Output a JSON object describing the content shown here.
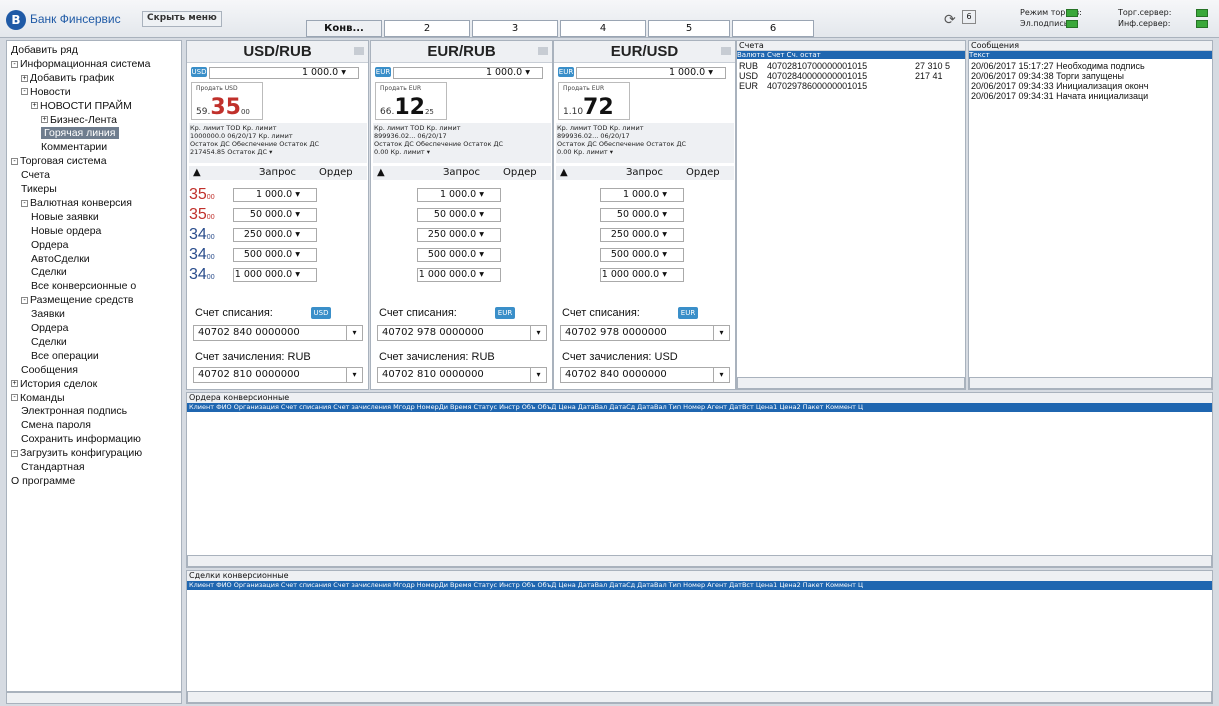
{
  "header": {
    "logo_letter": "B",
    "bank_name": "Банк Финсервис",
    "hide_menu": "Скрыть меню",
    "tabs": [
      "Конв...",
      "2",
      "3",
      "4",
      "5",
      "6"
    ],
    "status": {
      "trading_mode": "Режим торгов:",
      "trade_server": "Торг.сервер:",
      "signature": "Эл.подпись:",
      "info_server": "Инф.сервер:"
    },
    "refresh_icon": "⟳",
    "lock_icon": "6"
  },
  "tree": [
    {
      "label": "Добавить ряд",
      "indent": 0,
      "expander": ""
    },
    {
      "label": "Информационная система",
      "indent": 0,
      "expander": "-"
    },
    {
      "label": "Добавить график",
      "indent": 1,
      "expander": "+"
    },
    {
      "label": "Новости",
      "indent": 1,
      "expander": "-"
    },
    {
      "label": "НОВОСТИ ПРАЙМ",
      "indent": 2,
      "expander": "+"
    },
    {
      "label": "Бизнес-Лента",
      "indent": 3,
      "expander": "+"
    },
    {
      "label": "Горячая линия",
      "indent": 3,
      "expander": "",
      "selected": true
    },
    {
      "label": "Комментарии",
      "indent": 3,
      "expander": ""
    },
    {
      "label": "Торговая система",
      "indent": 0,
      "expander": "-"
    },
    {
      "label": "Счета",
      "indent": 1,
      "expander": ""
    },
    {
      "label": "Тикеры",
      "indent": 1,
      "expander": ""
    },
    {
      "label": "Валютная конверсия",
      "indent": 1,
      "expander": "-"
    },
    {
      "label": "Новые заявки",
      "indent": 2,
      "expander": ""
    },
    {
      "label": "Новые ордера",
      "indent": 2,
      "expander": ""
    },
    {
      "label": "Ордера",
      "indent": 2,
      "expander": ""
    },
    {
      "label": "АвтоСделки",
      "indent": 2,
      "expander": ""
    },
    {
      "label": "Сделки",
      "indent": 2,
      "expander": ""
    },
    {
      "label": "Все конверсионные о",
      "indent": 2,
      "expander": ""
    },
    {
      "label": "Размещение средств",
      "indent": 1,
      "expander": "-"
    },
    {
      "label": "Заявки",
      "indent": 2,
      "expander": ""
    },
    {
      "label": "Ордера",
      "indent": 2,
      "expander": ""
    },
    {
      "label": "Сделки",
      "indent": 2,
      "expander": ""
    },
    {
      "label": "Все операции",
      "indent": 2,
      "expander": ""
    },
    {
      "label": "Сообщения",
      "indent": 1,
      "expander": ""
    },
    {
      "label": "История сделок",
      "indent": 0,
      "expander": "+"
    },
    {
      "label": "Команды",
      "indent": 0,
      "expander": "-"
    },
    {
      "label": "Электронная подпись",
      "indent": 1,
      "expander": ""
    },
    {
      "label": "Смена пароля",
      "indent": 1,
      "expander": ""
    },
    {
      "label": "Сохранить информацию",
      "indent": 1,
      "expander": ""
    },
    {
      "label": "Загрузить конфигурацию",
      "indent": 0,
      "expander": "-"
    },
    {
      "label": "Стандартная",
      "indent": 1,
      "expander": ""
    },
    {
      "label": "О программе",
      "indent": 0,
      "expander": ""
    }
  ],
  "panels": [
    {
      "title": "USD/RUB",
      "ccy": "USD",
      "amount": "1 000.0 ▾",
      "sell_label": "Продать USD",
      "rate_prefix": "59.",
      "rate_big": "35",
      "rate_suffix": "00",
      "rate_red": true,
      "info1": "Кр. лимит      TOD        Кр. лимит",
      "info2": "1000000.0   06/20/17   Кр. лимит",
      "info3": "Остаток ДС  Обеспечение  Остаток ДС",
      "info4": "217454.85  Остаток ДС ▾",
      "btn_request": "Запрос",
      "btn_order": "Ордер",
      "levels": [
        {
          "price": "35",
          "sub": "00",
          "qty": "1 000.0 ▾"
        },
        {
          "price": "35",
          "sub": "00",
          "qty": "50 000.0 ▾"
        },
        {
          "price": "34",
          "sub": "00",
          "qty": "250 000.0 ▾"
        },
        {
          "price": "34",
          "sub": "00",
          "qty": "500 000.0 ▾"
        },
        {
          "price": "34",
          "sub": "00",
          "qty": "1 000 000.0 ▾"
        }
      ],
      "debit_label": "Счет списания:",
      "debit_ccy": "USD",
      "debit_acct": "40702 840  0000000",
      "credit_label": "Счет зачисления:  RUB",
      "credit_acct": "40702 810  0000000"
    },
    {
      "title": "EUR/RUB",
      "ccy": "EUR",
      "amount": "1 000.0 ▾",
      "sell_label": "Продать EUR",
      "rate_prefix": "66.",
      "rate_big": "12",
      "rate_suffix": "25",
      "rate_red": false,
      "info1": "Кр. лимит      TOD        Кр. лимит",
      "info2": "899936.02...  06/20/17",
      "info3": "Остаток ДС  Обеспечение  Остаток ДС",
      "info4": "0.00  Кр. лимит ▾",
      "btn_request": "Запрос",
      "btn_order": "Ордер",
      "levels": [
        {
          "price": "",
          "sub": "",
          "qty": "1 000.0 ▾"
        },
        {
          "price": "",
          "sub": "",
          "qty": "50 000.0 ▾"
        },
        {
          "price": "",
          "sub": "",
          "qty": "250 000.0 ▾"
        },
        {
          "price": "",
          "sub": "",
          "qty": "500 000.0 ▾"
        },
        {
          "price": "",
          "sub": "",
          "qty": "1 000 000.0 ▾"
        }
      ],
      "debit_label": "Счет списания:",
      "debit_ccy": "EUR",
      "debit_acct": "40702 978  0000000",
      "credit_label": "Счет зачисления:  RUB",
      "credit_acct": "40702 810  0000000"
    },
    {
      "title": "EUR/USD",
      "ccy": "EUR",
      "amount": "1 000.0 ▾",
      "sell_label": "Продать EUR",
      "rate_prefix": "1.10",
      "rate_big": "72",
      "rate_suffix": "",
      "rate_red": false,
      "info1": "Кр. лимит      TOD        Кр. лимит",
      "info2": "899936.02...  06/20/17",
      "info3": "Остаток ДС  Обеспечение  Остаток ДС",
      "info4": "0.00  Кр. лимит ▾",
      "btn_request": "Запрос",
      "btn_order": "Ордер",
      "levels": [
        {
          "price": "",
          "sub": "",
          "qty": "1 000.0 ▾"
        },
        {
          "price": "",
          "sub": "",
          "qty": "50 000.0 ▾"
        },
        {
          "price": "",
          "sub": "",
          "qty": "250 000.0 ▾"
        },
        {
          "price": "",
          "sub": "",
          "qty": "500 000.0 ▾"
        },
        {
          "price": "",
          "sub": "",
          "qty": "1 000 000.0 ▾"
        }
      ],
      "debit_label": "Счет списания:",
      "debit_ccy": "EUR",
      "debit_acct": "40702 978  0000000",
      "credit_label": "Счет зачисления:  USD",
      "credit_acct": "40702 840  0000000"
    }
  ],
  "accounts": {
    "title": "Счета",
    "header": "Валюта  Счет                          Сч. остат",
    "rows": [
      {
        "ccy": "RUB",
        "acct": "40702810700000001015",
        "bal": "27 310 5"
      },
      {
        "ccy": "USD",
        "acct": "40702840000000001015",
        "bal": "217 41"
      },
      {
        "ccy": "EUR",
        "acct": "40702978600000001015",
        "bal": ""
      }
    ]
  },
  "messages": {
    "title": "Сообщения",
    "header": "Текст",
    "rows": [
      "20/06/2017 15:17:27 Необходима подпись",
      "20/06/2017 09:34:38 Торги запущены",
      "20/06/2017 09:34:33 Инициализация оконч",
      "20/06/2017 09:34:31 Начата инициализаци"
    ]
  },
  "orders": {
    "title": "Ордера конверсионные",
    "header": "Клиент   ФИО   Организация   Счет списания   Счет зачисления   Мгодр   НомерДи   Время   Статус   Инстр   Объ   ОбъД   Цена   ДатаВал   ДатаСд   ДатаВал   Тип   Номер   Агент   ДатВст   Цена1   Цена2   Пакет   Коммент   Ц"
  },
  "deals": {
    "title": "Сделки конверсионные",
    "header": "Клиент   ФИО   Организация   Счет списания   Счет зачисления   Мгодр   НомерДи   Время   Статус   Инстр   Объ   ОбъД   Цена   ДатаВал   ДатаСд   ДатаВал   Тип   Номер   Агент   ДатВст   Цена1   Цена2   Пакет   Коммент   Ц"
  }
}
